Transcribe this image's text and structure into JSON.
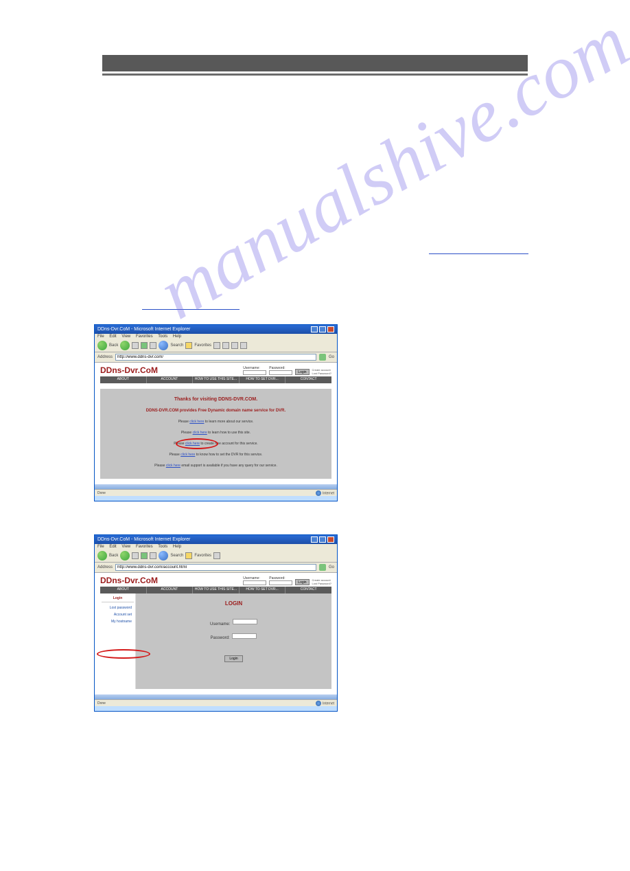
{
  "watermark": "manualshive.com",
  "browser": {
    "title": "DDns-Dvr.CoM - Microsoft Internet Explorer",
    "menus": [
      "File",
      "Edit",
      "View",
      "Favorites",
      "Tools",
      "Help"
    ],
    "toolbar": {
      "back": "Back",
      "search": "Search",
      "favorites": "Favorites"
    },
    "address_label": "Address",
    "url1": "http://www.ddns-dvr.com/",
    "url2": "http://www.ddns-dvr.com/account.html",
    "go": "Go",
    "status_done": "Done",
    "status_internet": "Internet"
  },
  "site": {
    "logo": "DDns-Dvr.CoM",
    "nav": [
      "ABOUT",
      "ACCOUNT",
      "HOW TO USE THIS SITE...",
      "HOW TO SET DVR...",
      "CONTACT"
    ],
    "login_username": "Username:",
    "login_password": "Password:",
    "login_button": "Login",
    "login_links_top": "Create account",
    "login_links_bottom": "Lost Password?"
  },
  "page1": {
    "thanks": "Thanks for visiting DDNS-DVR.COM.",
    "provides": "DDNS-DVR.COM provides Free Dynamic domain name service for DVR.",
    "l1_pre": "Please ",
    "l1_link": "click here",
    "l1_post": " to learn more about our service.",
    "l2_pre": "Please ",
    "l2_link": "click here",
    "l2_post": " to learn how to use this site.",
    "l3_pre": "Please ",
    "l3_link": "click here",
    "l3_post": " to create free account for this service.",
    "l4_pre": "Please ",
    "l4_link": "click here",
    "l4_post": " to know how to set the DVR for this service.",
    "l5_pre": "Please ",
    "l5_link": "click here",
    "l5_post": " email support is available if you have any query for our service."
  },
  "page2": {
    "sidebar_head": "Login",
    "sidebar_items": [
      "Lost password",
      "Account set",
      "My hostname"
    ],
    "login_title": "LOGIN",
    "username_label": "Username:",
    "password_label": "Password:",
    "login_button": "Login"
  }
}
